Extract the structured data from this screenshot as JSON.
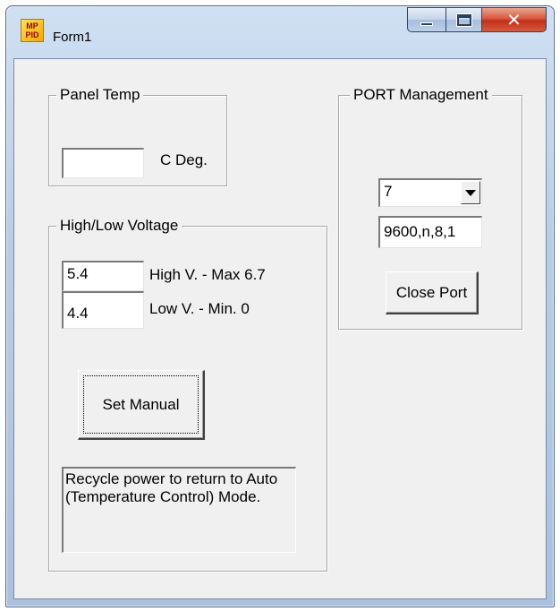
{
  "window": {
    "title": "Form1",
    "icon_text": "MP PID"
  },
  "panel_temp": {
    "legend": "Panel Temp",
    "value": "",
    "unit_label": "C Deg."
  },
  "voltage": {
    "legend": "High/Low Voltage",
    "high_value": "5.4",
    "high_label": "High V. - Max 6.7",
    "low_value": "4.4",
    "low_label": "Low V. - Min. 0",
    "set_button": "Set Manual",
    "note": "Recycle power to return to Auto (Temperature Control) Mode."
  },
  "port": {
    "legend": "PORT Management",
    "selected_port": "7",
    "settings": "9600,n,8,1",
    "close_button": "Close Port"
  }
}
